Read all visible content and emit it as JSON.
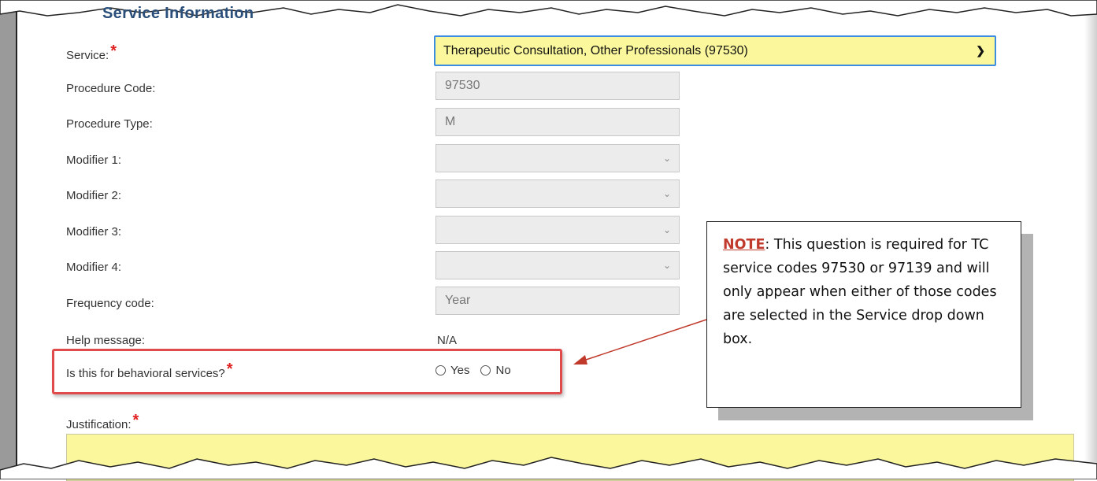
{
  "section": {
    "title": "Service Information"
  },
  "form": {
    "service": {
      "label": "Service:",
      "value": "Therapeutic Consultation, Other Professionals (97530)"
    },
    "procedure_code": {
      "label": "Procedure Code:",
      "value": "97530"
    },
    "procedure_type": {
      "label": "Procedure Type:",
      "value": "M"
    },
    "modifier_1": {
      "label": "Modifier 1:",
      "value": ""
    },
    "modifier_2": {
      "label": "Modifier 2:",
      "value": ""
    },
    "modifier_3": {
      "label": "Modifier 3:",
      "value": ""
    },
    "modifier_4": {
      "label": "Modifier 4:",
      "value": ""
    },
    "frequency_code": {
      "label": "Frequency code:",
      "value": "Year"
    },
    "help_message": {
      "label": "Help message:",
      "value": "N/A"
    },
    "behavioral": {
      "label": "Is this for behavioral services?",
      "options": [
        "Yes",
        "No"
      ]
    },
    "justification": {
      "label": "Justification:"
    },
    "required_marker": "*"
  },
  "note": {
    "heading": "NOTE",
    "body": ":  This question is required for TC service codes 97530 or 97139 and will only appear when either of those codes are selected in the Service drop down box."
  },
  "colors": {
    "required": "#e02020",
    "highlight_border": "#e04a4a",
    "input_yellow": "#fbf79c",
    "focus_blue": "#3a8de0"
  }
}
